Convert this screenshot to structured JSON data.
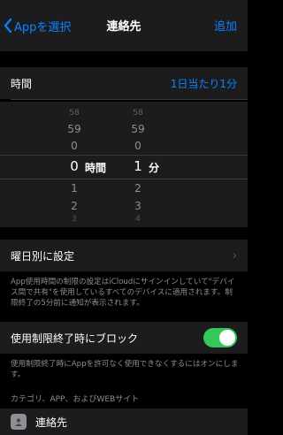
{
  "nav": {
    "back_label": "Appを選択",
    "title": "連絡先",
    "add_label": "追加"
  },
  "time": {
    "label": "時間",
    "value": "1日当たり1分"
  },
  "picker": {
    "hours": [
      "58",
      "59",
      "0",
      "1",
      "2",
      "3"
    ],
    "hours_unit": "時間",
    "minutes": [
      "0",
      "1",
      "2",
      "3",
      "4"
    ],
    "minutes_unit": "分",
    "minutes_above": [
      "59",
      "0"
    ],
    "hours_above": [
      "58"
    ]
  },
  "weekday": {
    "label": "曜日別に設定"
  },
  "weekday_note": "App使用時間の制限の設定はiCloudにサインインしていて\"デバイス間で共有\"を使用しているすべてのデバイスに適用されます。制限終了の5分前に通知が表示されます。",
  "block": {
    "label": "使用制限終了時にブロック",
    "enabled": true
  },
  "block_note": "使用制限終了時にAppを許可なく使用できなくするにはオンにします。",
  "category_header": "カテゴリ、APP、およびWEBサイト",
  "apps": [
    {
      "name": "連絡先",
      "icon": "contacts-icon"
    }
  ],
  "colors": {
    "accent": "#0a84ff",
    "toggle_on": "#34c759",
    "background": "#000000",
    "cell": "#1c1c1e"
  }
}
